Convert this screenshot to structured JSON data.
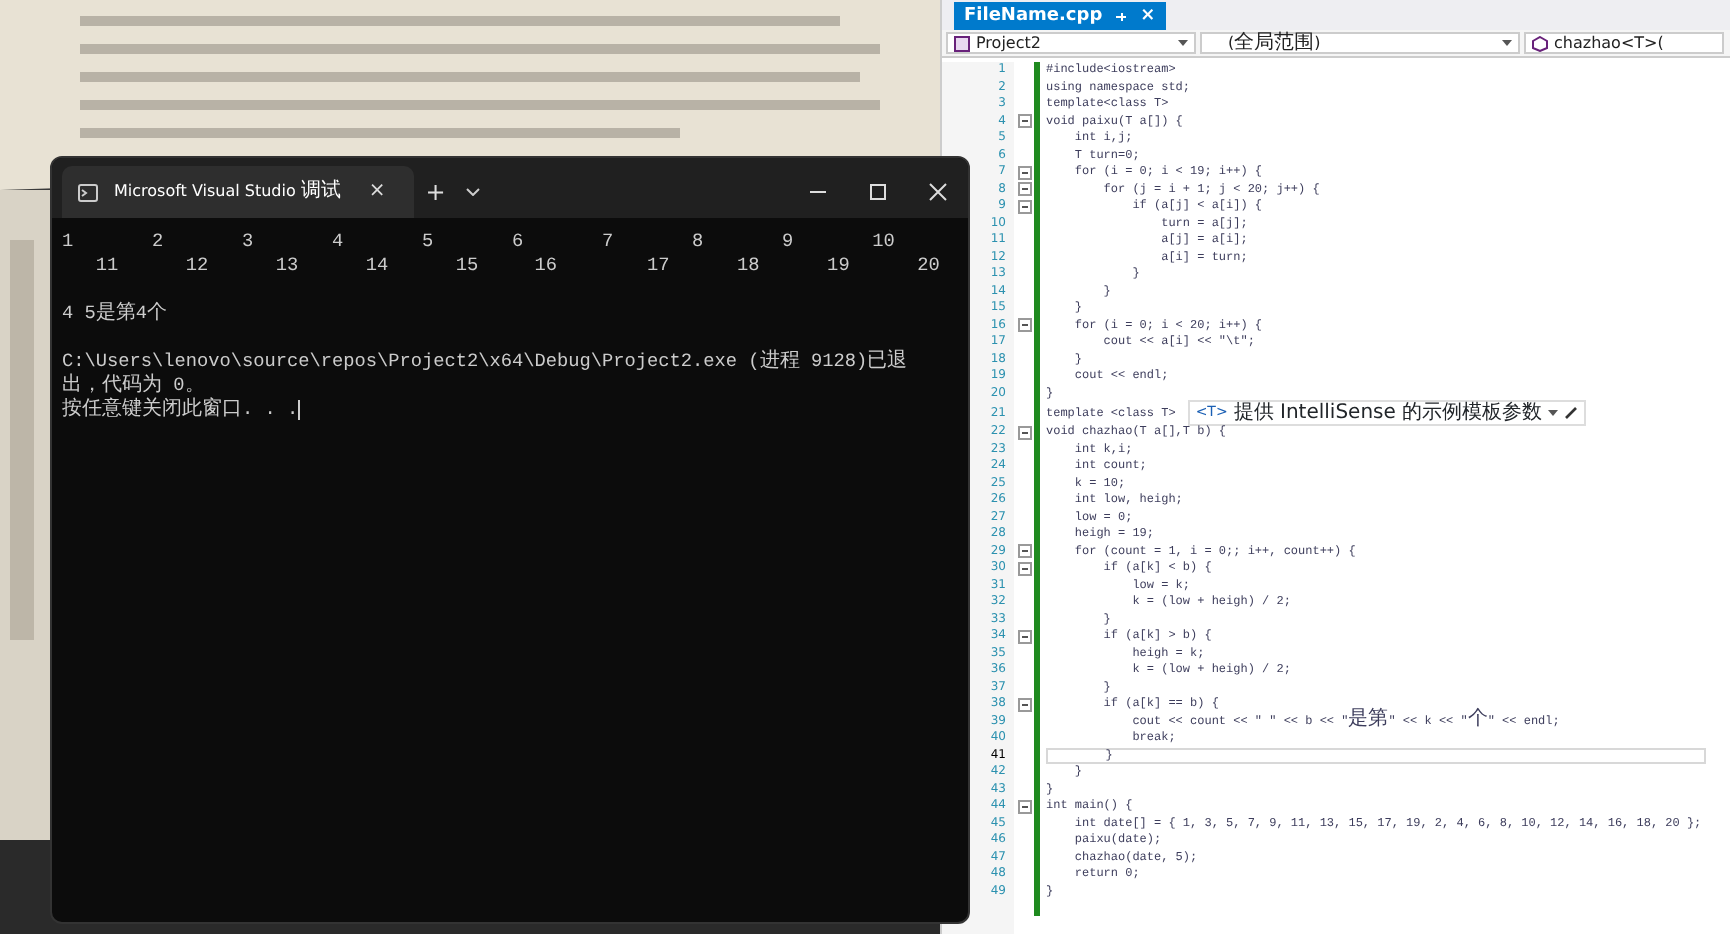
{
  "console": {
    "title": "Microsoft Visual Studio 调试",
    "tab_close": "×",
    "new_tab": "+",
    "cursor_visible": true,
    "blocks": [
      [
        "1       2       3       4       5       6       7       8       9       10",
        "   11      12      13      14      15     16        17      18      19      20"
      ],
      [
        "4 5是第4个"
      ],
      [
        "C:\\Users\\lenovo\\source\\repos\\Project2\\x64\\Debug\\Project2.exe (进程 9128)已退",
        "出，代码为 0。",
        "按任意键关闭此窗口. . ."
      ]
    ]
  },
  "editor": {
    "tab": {
      "label": "FileName.cpp",
      "selected": true,
      "close": "×"
    },
    "nav": [
      "Project2",
      "(全局范围)",
      "chazhao<T>("
    ],
    "hint": {
      "badge": "<T>",
      "text": "提供 IntelliSense 的示例模板参数"
    },
    "lines": [
      {
        "number": "1",
        "text": "#include<iostream>",
        "current": false
      },
      {
        "number": "2",
        "text": "using namespace std;",
        "current": false
      },
      {
        "number": "3",
        "text": "template<class T>",
        "current": false
      },
      {
        "number": "4",
        "text": "void paixu(T a[]) {",
        "current": false,
        "expanded": true
      },
      {
        "number": "5",
        "text": "    int i,j;",
        "current": false
      },
      {
        "number": "6",
        "text": "    T turn=0;",
        "current": false
      },
      {
        "number": "7",
        "text": "    for (i = 0; i < 19; i++) {",
        "current": false,
        "expanded": true
      },
      {
        "number": "8",
        "text": "        for (j = i + 1; j < 20; j++) {",
        "current": false,
        "expanded": true
      },
      {
        "number": "9",
        "text": "            if (a[j] < a[i]) {",
        "current": false,
        "expanded": true
      },
      {
        "number": "10",
        "text": "                turn = a[j];",
        "current": false
      },
      {
        "number": "11",
        "text": "                a[j] = a[i];",
        "current": false
      },
      {
        "number": "12",
        "text": "                a[i] = turn;",
        "current": false
      },
      {
        "number": "13",
        "text": "            }",
        "current": false
      },
      {
        "number": "14",
        "text": "        }",
        "current": false
      },
      {
        "number": "15",
        "text": "    }",
        "current": false
      },
      {
        "number": "16",
        "text": "    for (i = 0; i < 20; i++) {",
        "current": false,
        "expanded": true
      },
      {
        "number": "17",
        "text": "        cout << a[i] << \"\\t\";",
        "current": false
      },
      {
        "number": "18",
        "text": "    }",
        "current": false
      },
      {
        "number": "19",
        "text": "    cout << endl;",
        "current": false
      },
      {
        "number": "20",
        "text": "}",
        "current": false
      },
      {
        "number": "21",
        "text": "template <class T>",
        "current": false,
        "has_hint": true
      },
      {
        "number": "22",
        "text": "void chazhao(T a[],T b) {",
        "current": false,
        "expanded": true
      },
      {
        "number": "23",
        "text": "    int k,i;",
        "current": false
      },
      {
        "number": "24",
        "text": "    int count;",
        "current": false
      },
      {
        "number": "25",
        "text": "    k = 10;",
        "current": false
      },
      {
        "number": "26",
        "text": "    int low, heigh;",
        "current": false
      },
      {
        "number": "27",
        "text": "    low = 0;",
        "current": false
      },
      {
        "number": "28",
        "text": "    heigh = 19;",
        "current": false
      },
      {
        "number": "29",
        "text": "    for (count = 1, i = 0;; i++, count++) {",
        "current": false,
        "expanded": true
      },
      {
        "number": "30",
        "text": "        if (a[k] < b) {",
        "current": false,
        "expanded": true
      },
      {
        "number": "31",
        "text": "            low = k;",
        "current": false
      },
      {
        "number": "32",
        "text": "            k = (low + heigh) / 2;",
        "current": false
      },
      {
        "number": "33",
        "text": "        }",
        "current": false
      },
      {
        "number": "34",
        "text": "        if (a[k] > b) {",
        "current": false,
        "expanded": true
      },
      {
        "number": "35",
        "text": "            heigh = k;",
        "current": false
      },
      {
        "number": "36",
        "text": "            k = (low + heigh) / 2;",
        "current": false
      },
      {
        "number": "37",
        "text": "        }",
        "current": false
      },
      {
        "number": "38",
        "text": "        if (a[k] == b) {",
        "current": false,
        "expanded": true
      },
      {
        "number": "39",
        "text": "            cout << count << \" \" << b << \"是第\" << k << \"个\" << endl;",
        "current": false
      },
      {
        "number": "40",
        "text": "            break;",
        "current": false
      },
      {
        "number": "41",
        "text": "        }",
        "current": true
      },
      {
        "number": "42",
        "text": "    }",
        "current": false
      },
      {
        "number": "43",
        "text": "}",
        "current": false
      },
      {
        "number": "44",
        "text": "int main() {",
        "current": false,
        "expanded": true
      },
      {
        "number": "45",
        "text": "    int date[] = { 1, 3, 5, 7, 9, 11, 13, 15, 17, 19, 2, 4, 6, 8, 10, 12, 14, 16, 18, 20 };",
        "current": false
      },
      {
        "number": "46",
        "text": "    paixu(date);",
        "current": false
      },
      {
        "number": "47",
        "text": "    chazhao(date, 5);",
        "current": false
      },
      {
        "number": "48",
        "text": "    return 0;",
        "current": false
      },
      {
        "number": "49",
        "text": "}",
        "current": false
      }
    ]
  }
}
